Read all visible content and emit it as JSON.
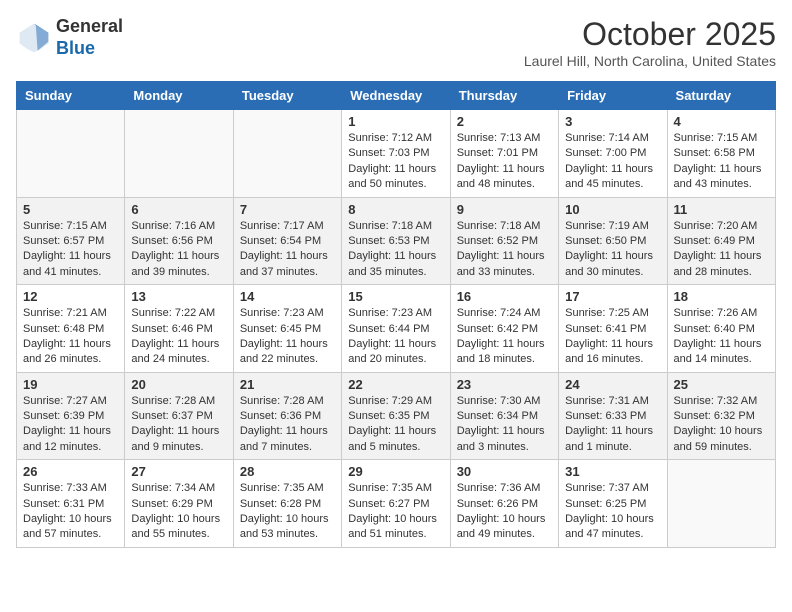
{
  "header": {
    "logo_line1": "General",
    "logo_line2": "Blue",
    "month_title": "October 2025",
    "location": "Laurel Hill, North Carolina, United States"
  },
  "weekdays": [
    "Sunday",
    "Monday",
    "Tuesday",
    "Wednesday",
    "Thursday",
    "Friday",
    "Saturday"
  ],
  "weeks": [
    [
      {
        "day": "",
        "info": ""
      },
      {
        "day": "",
        "info": ""
      },
      {
        "day": "",
        "info": ""
      },
      {
        "day": "1",
        "info": "Sunrise: 7:12 AM\nSunset: 7:03 PM\nDaylight: 11 hours\nand 50 minutes."
      },
      {
        "day": "2",
        "info": "Sunrise: 7:13 AM\nSunset: 7:01 PM\nDaylight: 11 hours\nand 48 minutes."
      },
      {
        "day": "3",
        "info": "Sunrise: 7:14 AM\nSunset: 7:00 PM\nDaylight: 11 hours\nand 45 minutes."
      },
      {
        "day": "4",
        "info": "Sunrise: 7:15 AM\nSunset: 6:58 PM\nDaylight: 11 hours\nand 43 minutes."
      }
    ],
    [
      {
        "day": "5",
        "info": "Sunrise: 7:15 AM\nSunset: 6:57 PM\nDaylight: 11 hours\nand 41 minutes."
      },
      {
        "day": "6",
        "info": "Sunrise: 7:16 AM\nSunset: 6:56 PM\nDaylight: 11 hours\nand 39 minutes."
      },
      {
        "day": "7",
        "info": "Sunrise: 7:17 AM\nSunset: 6:54 PM\nDaylight: 11 hours\nand 37 minutes."
      },
      {
        "day": "8",
        "info": "Sunrise: 7:18 AM\nSunset: 6:53 PM\nDaylight: 11 hours\nand 35 minutes."
      },
      {
        "day": "9",
        "info": "Sunrise: 7:18 AM\nSunset: 6:52 PM\nDaylight: 11 hours\nand 33 minutes."
      },
      {
        "day": "10",
        "info": "Sunrise: 7:19 AM\nSunset: 6:50 PM\nDaylight: 11 hours\nand 30 minutes."
      },
      {
        "day": "11",
        "info": "Sunrise: 7:20 AM\nSunset: 6:49 PM\nDaylight: 11 hours\nand 28 minutes."
      }
    ],
    [
      {
        "day": "12",
        "info": "Sunrise: 7:21 AM\nSunset: 6:48 PM\nDaylight: 11 hours\nand 26 minutes."
      },
      {
        "day": "13",
        "info": "Sunrise: 7:22 AM\nSunset: 6:46 PM\nDaylight: 11 hours\nand 24 minutes."
      },
      {
        "day": "14",
        "info": "Sunrise: 7:23 AM\nSunset: 6:45 PM\nDaylight: 11 hours\nand 22 minutes."
      },
      {
        "day": "15",
        "info": "Sunrise: 7:23 AM\nSunset: 6:44 PM\nDaylight: 11 hours\nand 20 minutes."
      },
      {
        "day": "16",
        "info": "Sunrise: 7:24 AM\nSunset: 6:42 PM\nDaylight: 11 hours\nand 18 minutes."
      },
      {
        "day": "17",
        "info": "Sunrise: 7:25 AM\nSunset: 6:41 PM\nDaylight: 11 hours\nand 16 minutes."
      },
      {
        "day": "18",
        "info": "Sunrise: 7:26 AM\nSunset: 6:40 PM\nDaylight: 11 hours\nand 14 minutes."
      }
    ],
    [
      {
        "day": "19",
        "info": "Sunrise: 7:27 AM\nSunset: 6:39 PM\nDaylight: 11 hours\nand 12 minutes."
      },
      {
        "day": "20",
        "info": "Sunrise: 7:28 AM\nSunset: 6:37 PM\nDaylight: 11 hours\nand 9 minutes."
      },
      {
        "day": "21",
        "info": "Sunrise: 7:28 AM\nSunset: 6:36 PM\nDaylight: 11 hours\nand 7 minutes."
      },
      {
        "day": "22",
        "info": "Sunrise: 7:29 AM\nSunset: 6:35 PM\nDaylight: 11 hours\nand 5 minutes."
      },
      {
        "day": "23",
        "info": "Sunrise: 7:30 AM\nSunset: 6:34 PM\nDaylight: 11 hours\nand 3 minutes."
      },
      {
        "day": "24",
        "info": "Sunrise: 7:31 AM\nSunset: 6:33 PM\nDaylight: 11 hours\nand 1 minute."
      },
      {
        "day": "25",
        "info": "Sunrise: 7:32 AM\nSunset: 6:32 PM\nDaylight: 10 hours\nand 59 minutes."
      }
    ],
    [
      {
        "day": "26",
        "info": "Sunrise: 7:33 AM\nSunset: 6:31 PM\nDaylight: 10 hours\nand 57 minutes."
      },
      {
        "day": "27",
        "info": "Sunrise: 7:34 AM\nSunset: 6:29 PM\nDaylight: 10 hours\nand 55 minutes."
      },
      {
        "day": "28",
        "info": "Sunrise: 7:35 AM\nSunset: 6:28 PM\nDaylight: 10 hours\nand 53 minutes."
      },
      {
        "day": "29",
        "info": "Sunrise: 7:35 AM\nSunset: 6:27 PM\nDaylight: 10 hours\nand 51 minutes."
      },
      {
        "day": "30",
        "info": "Sunrise: 7:36 AM\nSunset: 6:26 PM\nDaylight: 10 hours\nand 49 minutes."
      },
      {
        "day": "31",
        "info": "Sunrise: 7:37 AM\nSunset: 6:25 PM\nDaylight: 10 hours\nand 47 minutes."
      },
      {
        "day": "",
        "info": ""
      }
    ]
  ]
}
